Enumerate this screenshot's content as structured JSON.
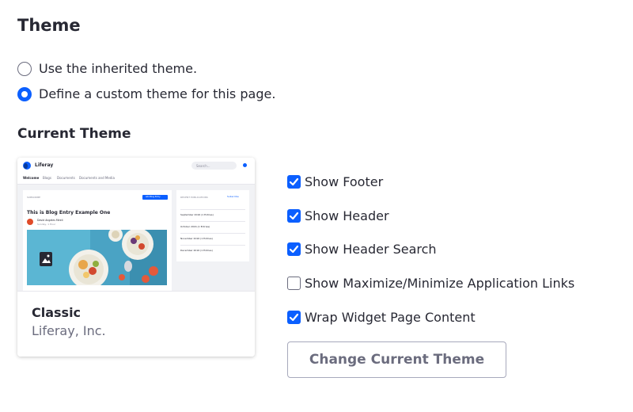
{
  "theme_section": {
    "title": "Theme",
    "options": [
      {
        "label": "Use the inherited theme.",
        "selected": false
      },
      {
        "label": "Define a custom theme for this page.",
        "selected": true
      }
    ]
  },
  "current_theme": {
    "title": "Current Theme",
    "card": {
      "name": "Classic",
      "author": "Liferay, Inc.",
      "preview": {
        "brand": "Liferay",
        "search_placeholder": "Search...",
        "nav": [
          "Welcome",
          "Blogs",
          "Documents",
          "Documents and Media"
        ],
        "section_label": "SUBSCRIBE",
        "button_label": "Add Blog Entry",
        "post_title": "This is Blog Entry Example One",
        "post_author": "David Angeles Mireli",
        "post_date": "Sunday, 1 Hour",
        "sidebar_title": "RECENT PUBLICATIONS",
        "sidebar_action": "Subscribe",
        "sidebar_items": [
          "September 2016 (1 Entries)",
          "October 2016 (1 Entries)",
          "November 2016 (1 Entries)",
          "December 2016 (1 Entries)"
        ]
      }
    }
  },
  "settings": [
    {
      "label": "Show Footer",
      "checked": true
    },
    {
      "label": "Show Header",
      "checked": true
    },
    {
      "label": "Show Header Search",
      "checked": true
    },
    {
      "label": "Show Maximize/Minimize Application Links",
      "checked": false
    },
    {
      "label": "Wrap Widget Page Content",
      "checked": true
    }
  ],
  "change_button_label": "Change Current Theme",
  "colors": {
    "accent": "#0b5fff",
    "text": "#272833",
    "secondary_text": "#6b6c7e"
  }
}
